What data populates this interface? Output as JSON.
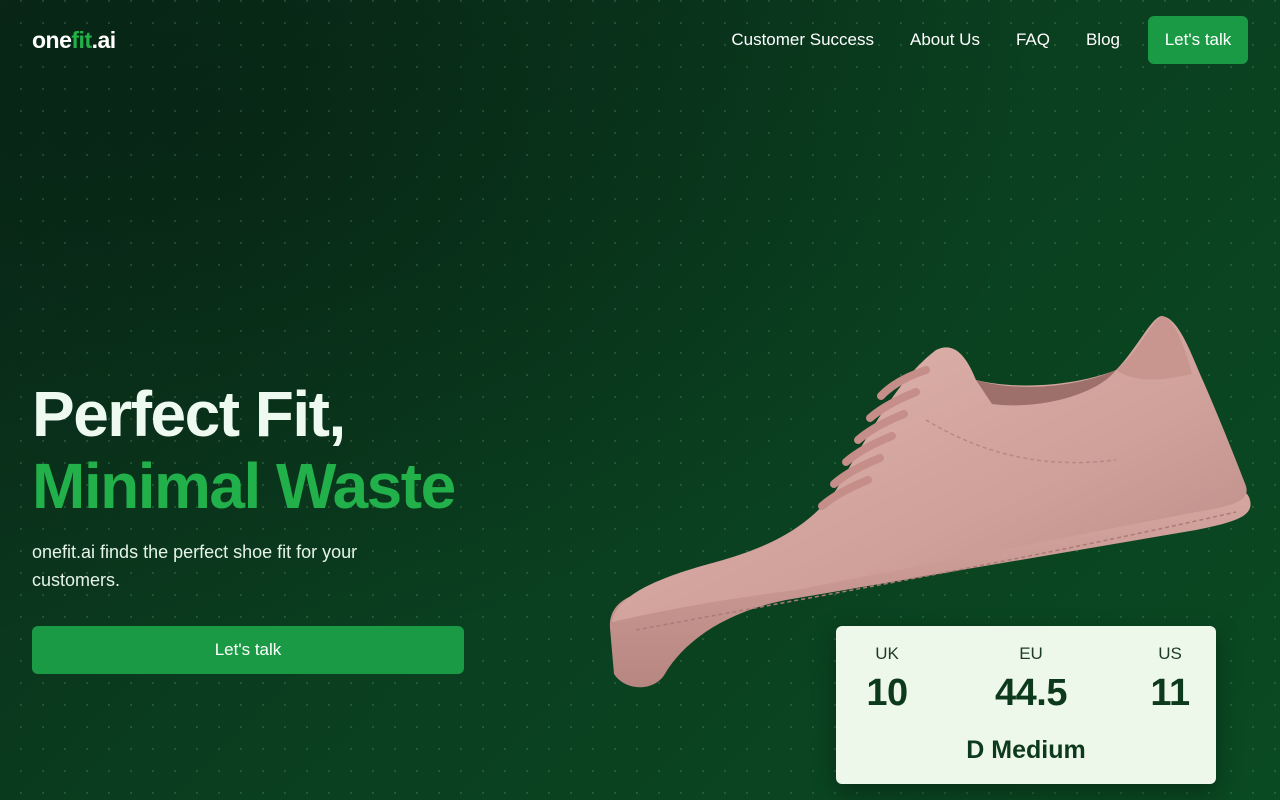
{
  "brand": {
    "logo_part1": "one",
    "logo_part2": "fit",
    "logo_part3": ".ai"
  },
  "nav": {
    "items": [
      "Customer Success",
      "About Us",
      "FAQ",
      "Blog"
    ],
    "cta_label": "Let's talk"
  },
  "hero": {
    "title_line1": "Perfect Fit,",
    "title_line2": "Minimal Waste",
    "subtitle": "onefit.ai finds the perfect shoe fit for your customers.",
    "cta_label": "Let's talk"
  },
  "size_card": {
    "sizes": [
      {
        "label": "UK",
        "value": "10"
      },
      {
        "label": "EU",
        "value": "44.5"
      },
      {
        "label": "US",
        "value": "11"
      }
    ],
    "width": "D Medium"
  },
  "colors": {
    "accent": "#22b04b",
    "button": "#1b9a45",
    "card_bg": "#eef8ea",
    "shoe": "#d7a9a3"
  }
}
